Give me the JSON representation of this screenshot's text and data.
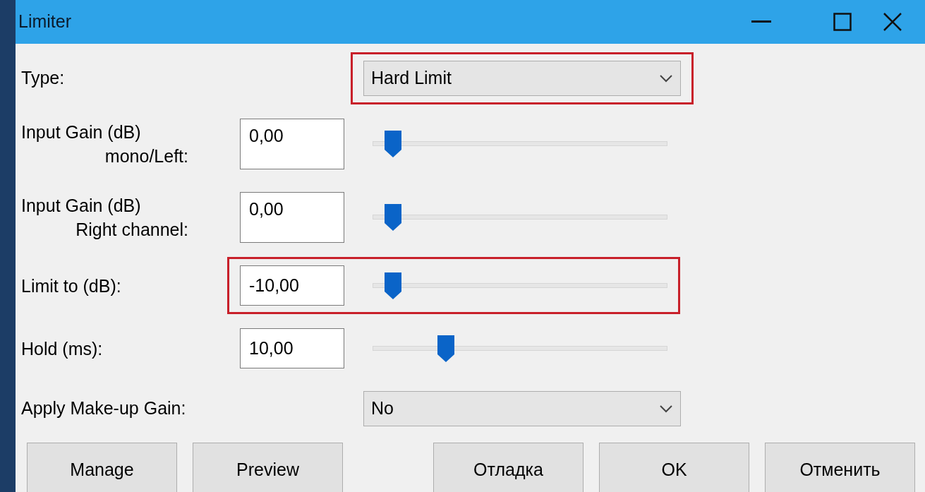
{
  "window": {
    "title": "Limiter"
  },
  "rows": [
    {
      "kind": "select",
      "label": "Type:",
      "value": "Hard Limit",
      "highlighted": true
    },
    {
      "kind": "slider",
      "label": "Input Gain (dB)",
      "label_2": "mono/Left:",
      "value": "0,00",
      "level": 0.03,
      "highlighted": false
    },
    {
      "kind": "slider",
      "label": "Input Gain (dB)",
      "label_2": "Right channel:",
      "value": "0,00",
      "level": 0.03,
      "highlighted": false
    },
    {
      "kind": "slider",
      "label": "Limit to (dB):",
      "value": "-10,00",
      "level": 0.03,
      "highlighted": true
    },
    {
      "kind": "slider",
      "label": "Hold (ms):",
      "value": "10,00",
      "level": 0.21,
      "highlighted": false
    },
    {
      "kind": "select",
      "label": "Apply Make-up Gain:",
      "value": "No",
      "highlighted": false
    }
  ],
  "buttons": [
    "Manage",
    "Preview",
    "Отладка",
    "OK",
    "Отменить"
  ]
}
